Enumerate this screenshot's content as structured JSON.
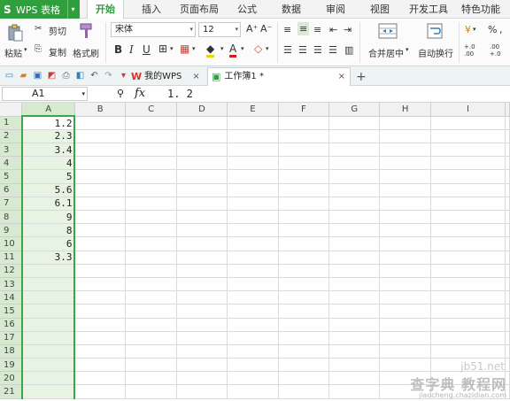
{
  "app": {
    "name": "WPS 表格"
  },
  "menu": {
    "tabs": [
      "开始",
      "插入",
      "页面布局",
      "公式",
      "数据",
      "审阅",
      "视图",
      "开发工具",
      "特色功能"
    ],
    "active": "开始"
  },
  "ribbon": {
    "paste_label": "粘贴",
    "cut_label": "剪切",
    "copy_label": "复制",
    "format_painter_label": "格式刷",
    "font_name": "宋体",
    "font_size": "12",
    "merge_center_label": "合并居中",
    "wrap_text_label": "自动换行",
    "bold": "B",
    "italic": "I",
    "underline": "U",
    "grow_font": "A⁺",
    "shrink_font": "A⁻",
    "font_color_glyph": "A",
    "currency_glyph": "¥",
    "percent_glyph": "%",
    "dec_inc_label": "+.0 .00",
    "dec_dec_label": ".00 +.0"
  },
  "documents": {
    "tabs": [
      {
        "label": "我的WPS",
        "close": "×"
      },
      {
        "label": "工作簿1 *",
        "close": "×"
      }
    ],
    "add_tab": "+"
  },
  "formula_bar": {
    "cell_ref": "A1",
    "fx": "fx",
    "value": "1. 2"
  },
  "sheet": {
    "columns": [
      "A",
      "B",
      "C",
      "D",
      "E",
      "F",
      "G",
      "H",
      "I"
    ],
    "selected_column": "A",
    "rows": [
      "1",
      "2",
      "3",
      "4",
      "5",
      "6",
      "7",
      "8",
      "9",
      "10",
      "11",
      "12",
      "13",
      "14",
      "15",
      "16",
      "17",
      "18",
      "19",
      "20",
      "21"
    ],
    "values_col_a": [
      "1.2",
      "2.3",
      "3.4",
      "4",
      "5",
      "5.6",
      "6.1",
      "9",
      "8",
      "6",
      "3.3",
      "",
      "",
      "",
      "",
      "",
      "",
      "",
      "",
      "",
      ""
    ]
  },
  "watermark": {
    "site": "jb51.net",
    "main": "查字典 教程网",
    "url": "jiaocheng.chazidian.com"
  },
  "colors": {
    "accent": "#2f9e3d",
    "selection_fill": "#e8f4e3"
  }
}
